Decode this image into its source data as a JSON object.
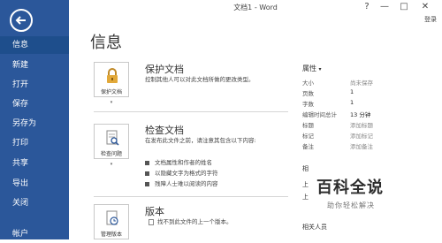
{
  "window": {
    "title": "文档1 - Word",
    "help": "?",
    "minimize": "—",
    "restore": "□",
    "close": "✕",
    "signin": "登录"
  },
  "sidebar": {
    "items": [
      {
        "label": "信息"
      },
      {
        "label": "新建"
      },
      {
        "label": "打开"
      },
      {
        "label": "保存"
      },
      {
        "label": "另存为"
      },
      {
        "label": "打印"
      },
      {
        "label": "共享"
      },
      {
        "label": "导出"
      },
      {
        "label": "关闭"
      },
      {
        "label": "帐户"
      }
    ]
  },
  "main": {
    "title": "信息",
    "protect": {
      "tile_label": "保护文档",
      "title": "保护文档",
      "desc": "控制其他人可以对此文档所做的更改类型。"
    },
    "inspect": {
      "tile_label": "检查问题",
      "title": "检查文档",
      "desc": "在发布此文件之前，请注意其包含以下内容:",
      "bullets": [
        "文档属性和作者的姓名",
        "以隐藏文字为格式的字符",
        "残障人士难以阅读的内容"
      ]
    },
    "versions": {
      "tile_label": "管理版本",
      "title": "版本",
      "desc": "找不到此文件的上一个版本。"
    }
  },
  "properties": {
    "title": "属性",
    "caret": "▾",
    "rows": [
      {
        "key": "大小",
        "value": "尚未保存",
        "muted": true
      },
      {
        "key": "页数",
        "value": "1"
      },
      {
        "key": "字数",
        "value": "1"
      },
      {
        "key": "编辑时间总计",
        "value": "13 分钟"
      },
      {
        "key": "标题",
        "value": "添加标题",
        "muted": true
      },
      {
        "key": "标记",
        "value": "添加标记",
        "muted": true
      },
      {
        "key": "备注",
        "value": "添加备注",
        "muted": true
      }
    ],
    "related_cut": [
      "相",
      "上",
      "上"
    ],
    "related_people": "相关人员"
  },
  "watermark": {
    "main": "百科全说",
    "sub": "助你轻松解决"
  },
  "colors": {
    "sidebar": "#2b579a",
    "sidebar_active": "#1e4e8c"
  }
}
